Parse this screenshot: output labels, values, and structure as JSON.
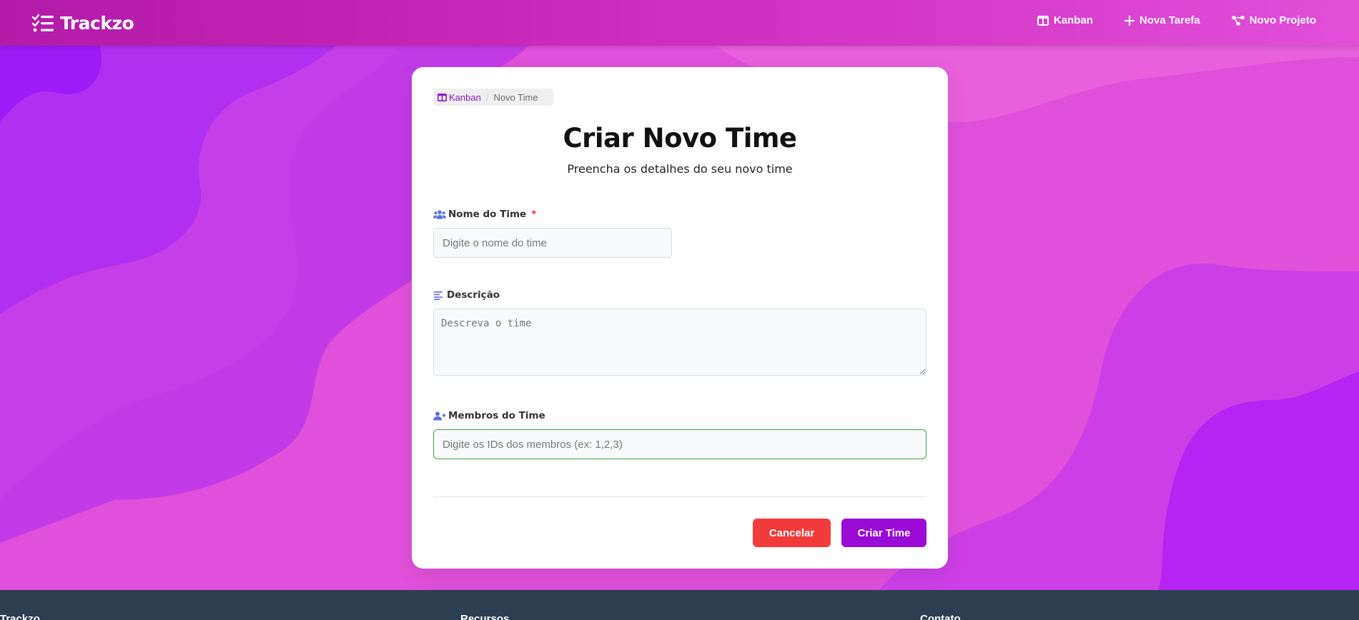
{
  "navbar": {
    "brand": "Trackzo",
    "links": [
      {
        "label": "Kanban",
        "icon": "columns-icon"
      },
      {
        "label": "Nova Tarefa",
        "icon": "plus-icon"
      },
      {
        "label": "Novo Projeto",
        "icon": "project-diagram-icon"
      }
    ]
  },
  "breadcrumb": {
    "link_label": "Kanban",
    "current": "Novo Time",
    "separator": "/"
  },
  "form": {
    "title": "Criar Novo Time",
    "subtitle": "Preencha os detalhes do seu novo time",
    "name": {
      "label": "Nome do Time",
      "required_mark": "*",
      "placeholder": "Digite o nome do time",
      "value": ""
    },
    "description": {
      "label": "Descrição",
      "placeholder": "Descreva o time",
      "value": ""
    },
    "members": {
      "label": "Membros do Time",
      "placeholder": "Digite os IDs dos membros (ex: 1,2,3)",
      "value": ""
    },
    "cancel_label": "Cancelar",
    "submit_label": "Criar Time"
  },
  "footer": {
    "columns": [
      "Trackzo",
      "Recursos",
      "Contato"
    ]
  },
  "colors": {
    "accent": "#9a0cd6",
    "danger": "#f23b3b",
    "focus_border": "#38a84a",
    "footer_bg": "#2e3e52",
    "label_icon": "#5b6ee1"
  }
}
